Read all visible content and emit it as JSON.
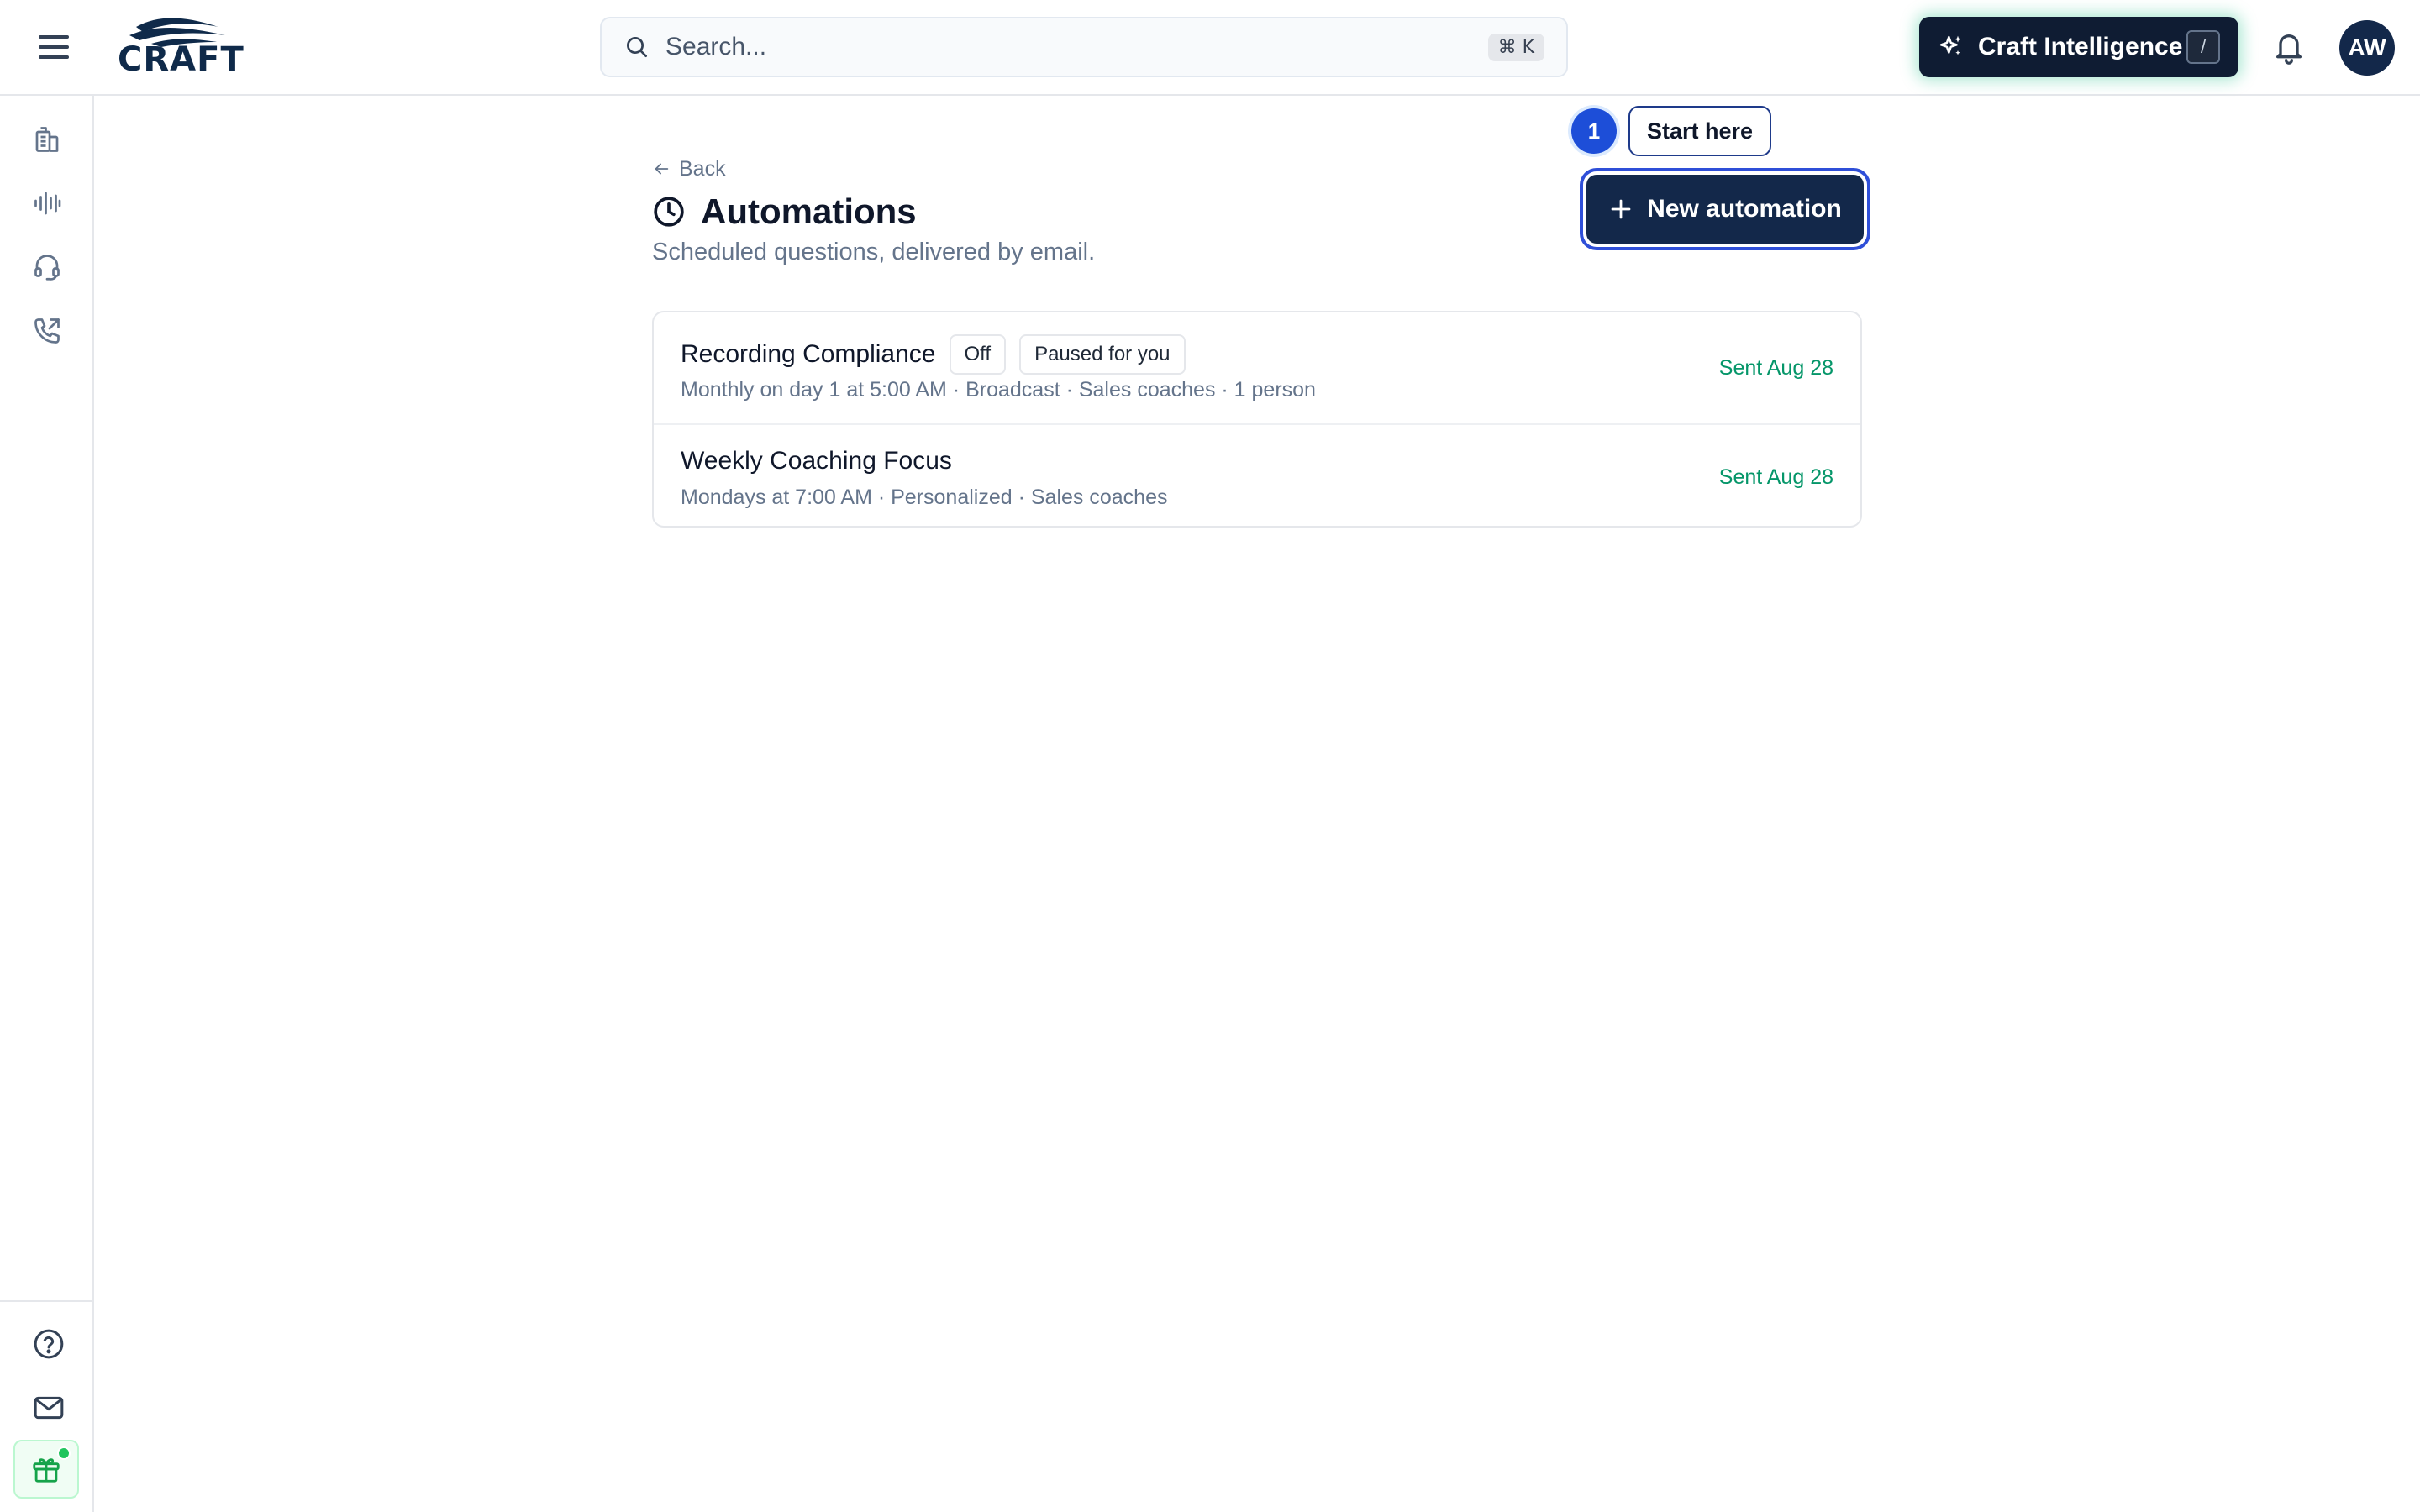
{
  "app": {
    "logo_text": "CRAFT",
    "search": {
      "placeholder": "Search...",
      "shortcut": "⌘ K"
    },
    "assistant": {
      "label": "Craft Intelligence",
      "shortcut": "/"
    },
    "user": {
      "initials": "AW"
    }
  },
  "sidebar": {
    "items": [
      {
        "name": "buildings-icon"
      },
      {
        "name": "audio-waveform-icon"
      },
      {
        "name": "headset-icon"
      },
      {
        "name": "phone-outgoing-icon"
      }
    ],
    "bottom": [
      {
        "name": "help-circle-icon"
      },
      {
        "name": "mail-icon"
      },
      {
        "name": "gift-icon"
      }
    ]
  },
  "page": {
    "back_label": "Back",
    "title": "Automations",
    "subtitle": "Scheduled questions, delivered by email.",
    "onboarding": {
      "step": "1",
      "hint": "Start here"
    },
    "new_button_label": "New automation"
  },
  "automations": [
    {
      "name": "Recording Compliance",
      "tags": [
        "Off",
        "Paused for you"
      ],
      "meta": "Monthly on day 1 at 5:00 AM · Broadcast · Sales coaches · 1 person",
      "status": "Sent Aug 28"
    },
    {
      "name": "Weekly Coaching Focus",
      "tags": [],
      "meta": "Mondays at 7:00 AM · Personalized · Sales coaches",
      "status": "Sent Aug 28"
    }
  ],
  "colors": {
    "brand_navy": "#13284a",
    "assistant_bg": "#0f1c33",
    "status_green": "#059669",
    "step_blue": "#1d4ed8"
  }
}
